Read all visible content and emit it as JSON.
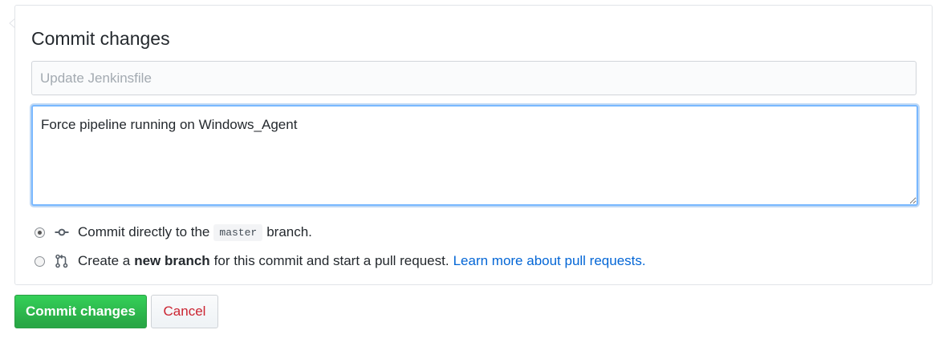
{
  "form": {
    "title": "Commit changes",
    "summary_placeholder": "Update Jenkinsfile",
    "summary_value": "",
    "description_value": "Force pipeline running on Windows_Agent"
  },
  "options": {
    "direct": {
      "checked": true,
      "icon": "git-commit-icon",
      "text_before": "Commit directly to the",
      "branch_name": "master",
      "text_after": "branch."
    },
    "new_branch": {
      "checked": false,
      "icon": "git-pull-request-icon",
      "text_before": "Create a",
      "bold_text": "new branch",
      "text_after": "for this commit and start a pull request.",
      "link_text": "Learn more about pull requests."
    }
  },
  "buttons": {
    "commit_label": "Commit changes",
    "cancel_label": "Cancel"
  },
  "colors": {
    "primary_green": "#28a745",
    "cancel_red": "#cb2431",
    "link_blue": "#0366d6",
    "focus_blue": "#79b8ff"
  }
}
